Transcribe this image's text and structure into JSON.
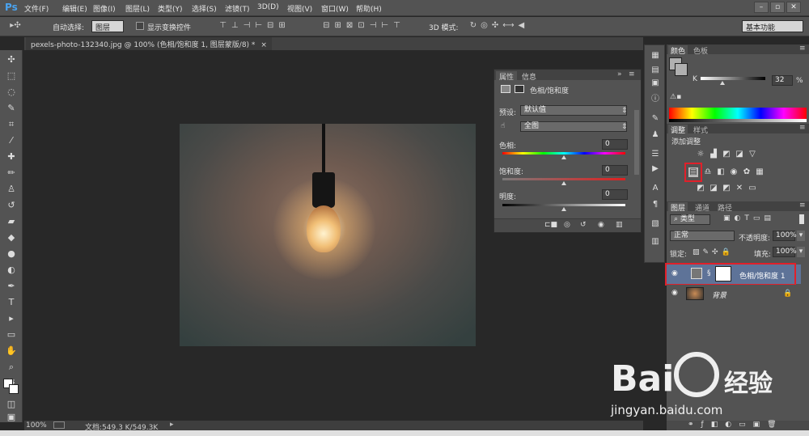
{
  "app": {
    "logo": "Ps"
  },
  "menu": [
    "文件(F)",
    "编辑(E)",
    "图像(I)",
    "图层(L)",
    "类型(Y)",
    "选择(S)",
    "滤镜(T)",
    "3D(D)",
    "视图(V)",
    "窗口(W)",
    "帮助(H)"
  ],
  "window_controls": {
    "minimize": "–",
    "restore": "▫",
    "close": "✕"
  },
  "options": {
    "auto_select_label": "自动选择:",
    "auto_select_value": "图层",
    "show_transform_label": "显示变换控件",
    "mode_3d_label": "3D 模式:",
    "workspace": "基本功能"
  },
  "document_tab": {
    "title": "pexels-photo-132340.jpg @ 100% (色相/饱和度 1, 图层蒙版/8) *",
    "close": "×"
  },
  "status": {
    "zoom": "100%",
    "doc": "文档:549.3 K/549.3K"
  },
  "properties": {
    "tabs": [
      "属性",
      "信息"
    ],
    "title": "色相/饱和度",
    "preset_label": "预设:",
    "preset_value": "默认值",
    "range_value": "全图",
    "hue_label": "色相:",
    "hue_value": "0",
    "sat_label": "饱和度:",
    "sat_value": "0",
    "light_label": "明度:",
    "light_value": "0"
  },
  "color_panel": {
    "tabs": [
      "颜色",
      "色板"
    ],
    "channel": "K",
    "value": "32",
    "unit": "%"
  },
  "adjust_panel": {
    "tabs": [
      "调整",
      "样式"
    ],
    "add_label": "添加调整"
  },
  "layers_panel": {
    "tabs": [
      "图层",
      "通道",
      "路径"
    ],
    "filter": "类型",
    "blend": "正常",
    "opacity_label": "不透明度:",
    "opacity": "100%",
    "lock_label": "锁定:",
    "fill_label": "填充:",
    "fill": "100%",
    "layers": [
      {
        "name": "色相/饱和度 1"
      },
      {
        "name": "背景"
      }
    ]
  },
  "watermark": {
    "brand": "Bai",
    "brand2": "经验",
    "url": "jingyan.baidu.com"
  },
  "colors": {
    "accent": "#4aa3ef",
    "highlight_box": "#e1202a",
    "selected_layer": "#5e7398"
  }
}
